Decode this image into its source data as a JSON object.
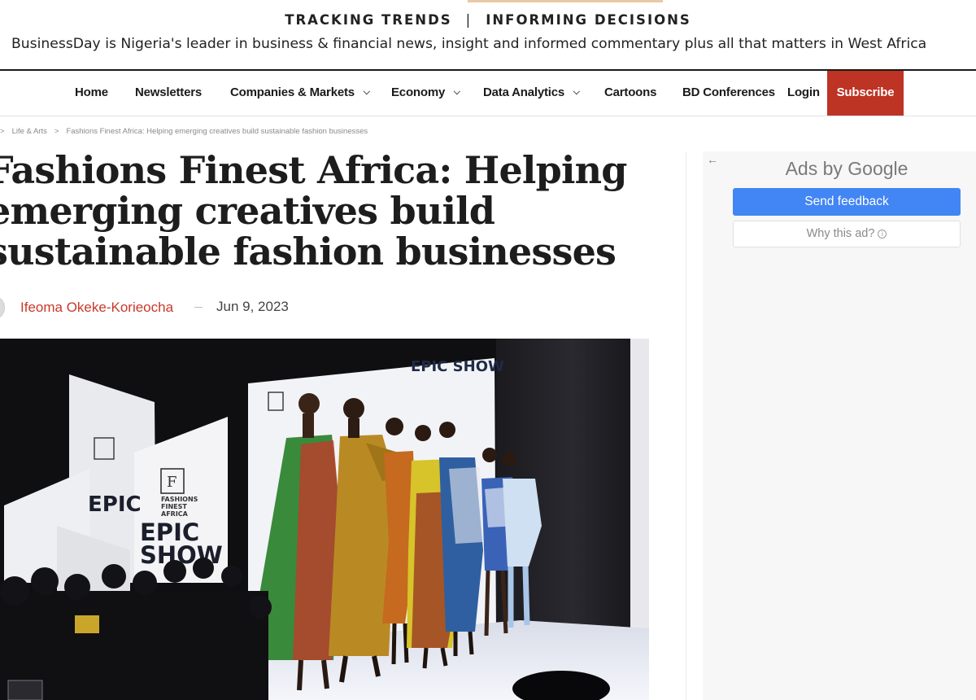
{
  "banner": {
    "tagline_left": "TRACKING TRENDS",
    "tagline_sep": "|",
    "tagline_right": "INFORMING DECISIONS",
    "blurb": "BusinessDay is Nigeria's leader in business & financial news, insight and informed commentary plus all that matters in West Africa"
  },
  "nav": {
    "items": [
      {
        "label": "Home"
      },
      {
        "label": "Newsletters"
      },
      {
        "label": "Companies & Markets"
      },
      {
        "label": "Economy"
      },
      {
        "label": "Data Analytics"
      },
      {
        "label": "Cartoons"
      },
      {
        "label": "BD Conferences"
      },
      {
        "label": "Login"
      },
      {
        "label": "Subscribe"
      }
    ],
    "subscribe_color": "#bd3324"
  },
  "breadcrumb": {
    "sep": ">",
    "section": "Life & Arts",
    "current": "Fashions Finest Africa: Helping emerging creatives build sustainable fashion businesses"
  },
  "article": {
    "title_lines": [
      "Fashions Finest Africa: Helping",
      "emerging creatives build",
      "sustainable fashion businesses"
    ],
    "author": "Ifeoma Okeke-Korieocha",
    "date": "Jun 9, 2023",
    "author_color": "#c8382a",
    "image": {
      "stage_sign": "EPIC SHOW",
      "panel_brand_1": "FASHIONS",
      "panel_brand_2": "FINEST",
      "panel_brand_3": "AFRICA",
      "panel_logo": "F",
      "panel_epic": "EPIC",
      "panel_show": "SHOW"
    }
  },
  "sidebar": {
    "ads_by": "Ads by Google",
    "send_feedback": "Send feedback",
    "why_this_ad": "Why this ad?",
    "info_glyph": "i",
    "back_glyph": "←",
    "feedback_color": "#4285f4"
  }
}
